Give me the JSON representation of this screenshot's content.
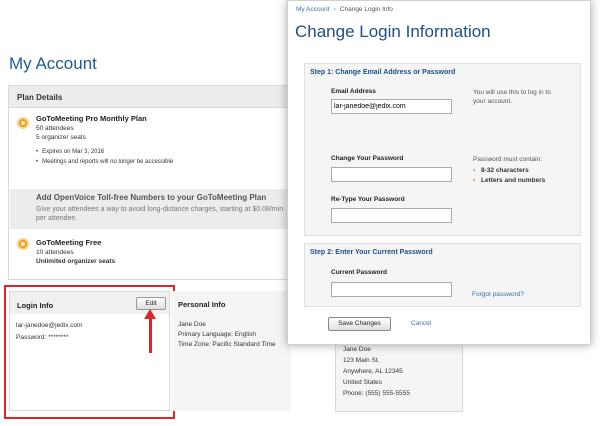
{
  "account": {
    "title": "My Account",
    "plan_details": {
      "header": "Plan Details",
      "plan1": {
        "name": "GoToMeeting Pro Monthly Plan",
        "attendees": "50 attendees",
        "seats": "5 organizer seats",
        "bullets": [
          "Expires on Mar 3, 2016",
          "Meetings and reports will no longer be accessible"
        ]
      },
      "addon": {
        "title": "Add OpenVoice Toll-free Numbers to your GoToMeeting Plan",
        "description": "Give your attendees a way to avoid long-distance charges, starting at $0.08/min per attendee."
      },
      "plan2": {
        "name": "GoToMeeting Free",
        "attendees": "10 attendees",
        "seats": "Unlimited organizer seats"
      }
    },
    "login_info": {
      "title": "Login Info",
      "edit_label": "Edit",
      "email": "lar-janedoe@jedix.com",
      "password": "Password: ********"
    },
    "personal_info": {
      "title": "Personal Info",
      "name": "Jane Doe",
      "language": "Primary Language: English",
      "timezone": "Time Zone: Pacific Standard Time"
    },
    "billing": {
      "name": "Jane Doe",
      "street": "123 Main St.",
      "city": "Anywhere, AL 12345",
      "country": "United States",
      "phone": "Phone: (555) 555-5555"
    }
  },
  "modal": {
    "breadcrumb": {
      "link": "My Account",
      "separator": "›",
      "current": "Change Login Info"
    },
    "title": "Change Login Information",
    "step1": {
      "title": "Step 1: Change Email Address or Password",
      "email_label": "Email Address",
      "email_value": "lar-janedoe@jedix.com",
      "email_hint": "You will use this to log in to your account.",
      "password_label": "Change Your Password",
      "retype_label": "Re-Type Your Password",
      "password_hint": "Password must contain:",
      "requirements": [
        "8-32 characters",
        "Letters and numbers"
      ]
    },
    "step2": {
      "title": "Step 2: Enter Your Current Password",
      "current_label": "Current Password",
      "forgot_link": "Forgot password?"
    },
    "save_label": "Save Changes",
    "cancel_label": "Cancel"
  },
  "colors": {
    "accent": "#1e4f87",
    "link": "#3a6fb0",
    "highlight": "#d9262b",
    "plan_icon": "#f39c1a"
  }
}
